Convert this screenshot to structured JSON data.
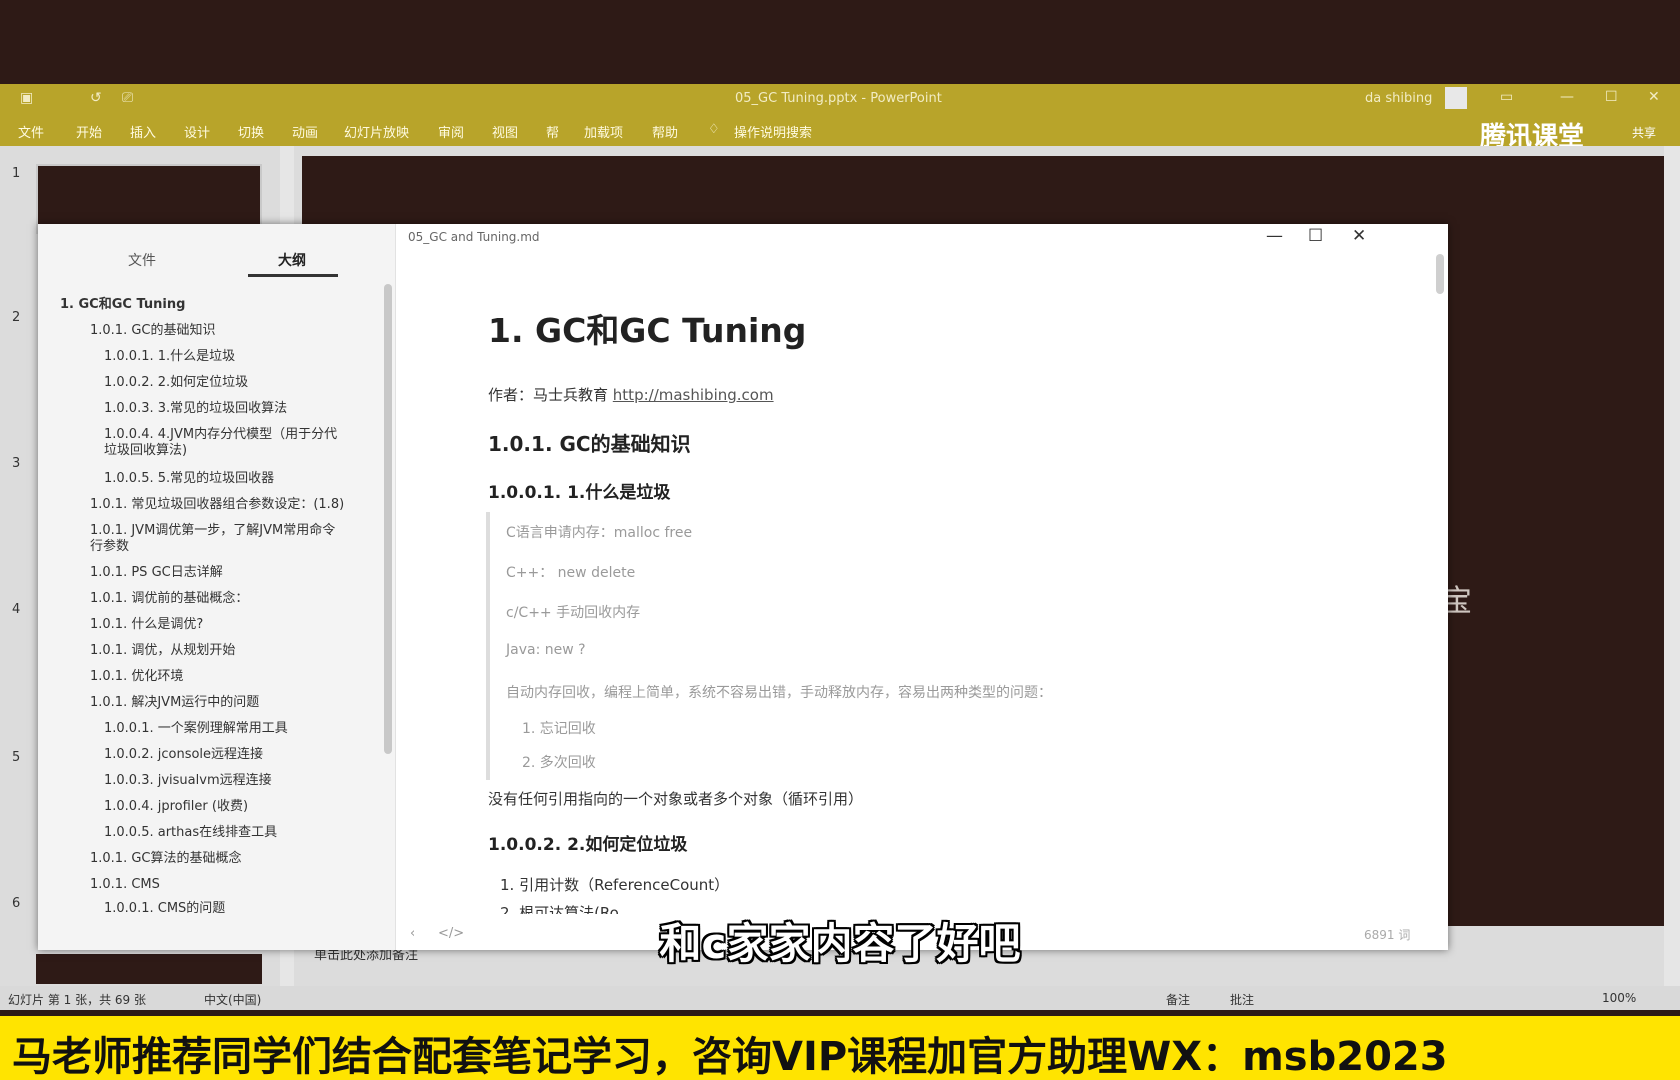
{
  "ppt": {
    "doc_title": "05_GC Tuning.pptx - PowerPoint",
    "user": "da shibing",
    "ribbon_tabs": [
      "文件",
      "开始",
      "插入",
      "设计",
      "切换",
      "动画",
      "幻灯片放映",
      "审阅",
      "视图",
      "帮",
      "加载项",
      "帮助",
      "操作说明搜索"
    ],
    "brand": "腾讯课堂",
    "brand_sub": "共享",
    "slide_numbers": [
      "1",
      "2",
      "3",
      "4",
      "5",
      "6"
    ],
    "notes_placeholder": "单击此处添加备注",
    "status": {
      "slide_info": "幻灯片 第 1 张，共 69 张",
      "language": "中文(中国)",
      "notes": "备注",
      "comments": "批注",
      "zoom": "100%"
    },
    "slide_side_text": "宝"
  },
  "typora": {
    "filename": "05_GC and Tuning.md",
    "tabs": {
      "files": "文件",
      "outline": "大纲"
    },
    "outline": [
      "1. GC和GC Tuning",
      "1.0.1. GC的基础知识",
      "1.0.0.1. 1.什么是垃圾",
      "1.0.0.2. 2.如何定位垃圾",
      "1.0.0.3. 3.常见的垃圾回收算法",
      "1.0.0.4. 4.JVM内存分代模型（用于分代",
      "垃圾回收算法)",
      "1.0.0.5. 5.常见的垃圾回收器",
      "1.0.1. 常见垃圾回收器组合参数设定：(1.8)",
      "1.0.1. JVM调优第一步，了解JVM常用命令",
      "行参数",
      "1.0.1. PS GC日志详解",
      "1.0.1. 调优前的基础概念：",
      "1.0.1. 什么是调优?",
      "1.0.1. 调优，从规划开始",
      "1.0.1. 优化环境",
      "1.0.1. 解决JVM运行中的问题",
      "1.0.0.1. 一个案例理解常用工具",
      "1.0.0.2. jconsole远程连接",
      "1.0.0.3. jvisualvm远程连接",
      "1.0.0.4. jprofiler (收费)",
      "1.0.0.5. arthas在线排查工具",
      "1.0.1. GC算法的基础概念",
      "1.0.1. CMS",
      "1.0.0.1. CMS的问题"
    ],
    "content": {
      "h1": "1. GC和GC Tuning",
      "author_label": "作者：马士兵教育",
      "author_link": "http://mashibing.com",
      "h3": "1.0.1. GC的基础知识",
      "h4_1": "1.0.0.1. 1.什么是垃圾",
      "quote": [
        "C语言申请内存：malloc free",
        "C++： new delete",
        "c/C++ 手动回收内存",
        "Java: new ?",
        "自动内存回收，编程上简单，系统不容易出错，手动释放内存，容易出两种类型的问题：",
        "1. 忘记回收",
        "2. 多次回收"
      ],
      "para_1": "没有任何引用指向的一个对象或者多个对象（循环引用）",
      "h4_2": "1.0.0.2. 2.如何定位垃圾",
      "list": [
        "1. 引用计数（ReferenceCount）",
        "2. 根可达算法(Ro"
      ]
    },
    "word_count": "6891 词"
  },
  "subtitle": "和c家家内容了好吧",
  "banner": "马老师推荐同学们结合配套笔记学习，咨询VIP课程加官方助理WX：msb2023"
}
